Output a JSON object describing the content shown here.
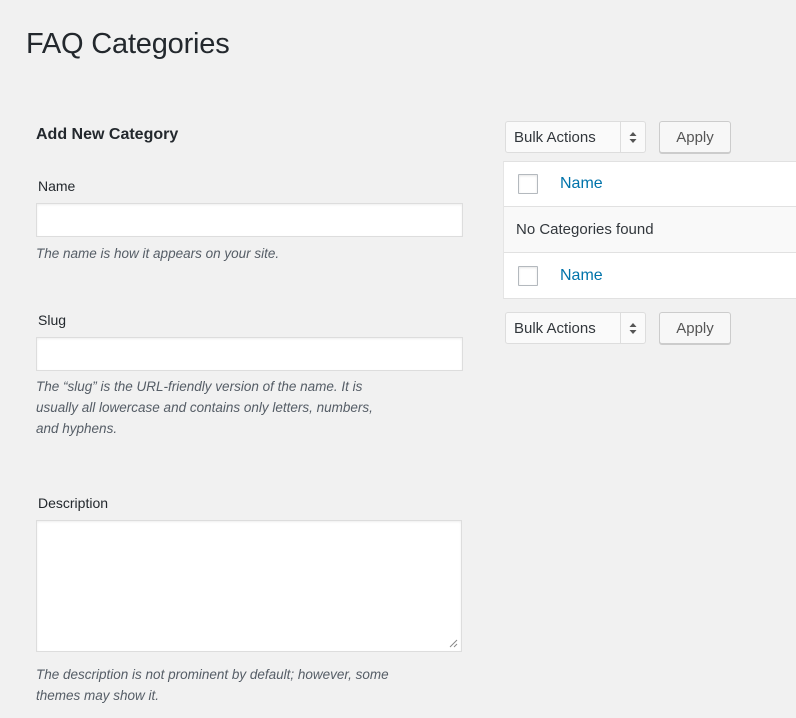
{
  "page": {
    "title": "FAQ Categories"
  },
  "form": {
    "section_title": "Add New Category",
    "name": {
      "label": "Name",
      "value": "",
      "help": "The name is how it appears on your site."
    },
    "slug": {
      "label": "Slug",
      "value": "",
      "help_lines": [
        "The “slug” is the URL-friendly version of the name. It is",
        "usually all lowercase and contains only letters, numbers,",
        "and hyphens."
      ]
    },
    "description": {
      "label": "Description",
      "value": "",
      "help_lines": [
        "The description is not prominent by default; however, some",
        "themes may show it."
      ]
    }
  },
  "list": {
    "top_bulk": {
      "selected": "Bulk Actions",
      "apply_label": "Apply"
    },
    "bottom_bulk": {
      "selected": "Bulk Actions",
      "apply_label": "Apply"
    },
    "header_column": "Name",
    "footer_column": "Name",
    "empty_message": "No Categories found"
  },
  "colors": {
    "link": "#0073aa",
    "background": "#f1f1f1"
  },
  "icons": {
    "select_arrows": "updown-arrows-icon",
    "resize": "resize-grip-icon"
  }
}
